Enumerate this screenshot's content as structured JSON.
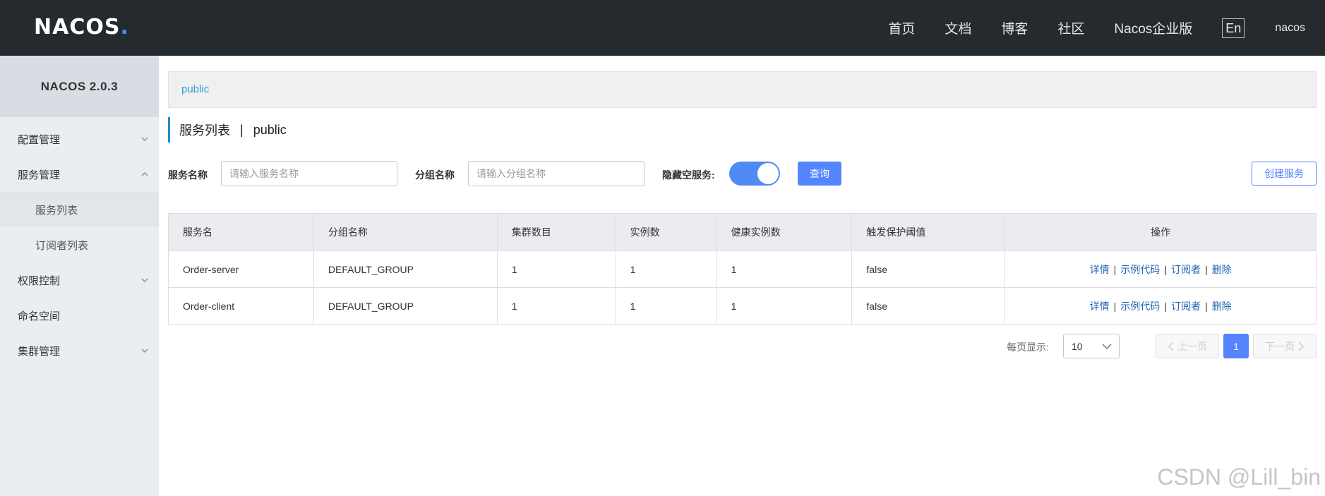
{
  "header": {
    "logo_text": "NACOS",
    "logo_dot": ".",
    "nav": [
      "首页",
      "文档",
      "博客",
      "社区",
      "Nacos企业版"
    ],
    "lang": "En",
    "user": "nacos"
  },
  "sidebar": {
    "title": "NACOS 2.0.3",
    "items": [
      {
        "label": "配置管理",
        "arrow": "down"
      },
      {
        "label": "服务管理",
        "arrow": "up"
      },
      {
        "label": "服务列表"
      },
      {
        "label": "订阅者列表"
      },
      {
        "label": "权限控制",
        "arrow": "down"
      },
      {
        "label": "命名空间"
      },
      {
        "label": "集群管理",
        "arrow": "down"
      }
    ]
  },
  "namespace": "public",
  "page": {
    "title": "服务列表",
    "separator": "|",
    "namespace": "public"
  },
  "filter": {
    "service_label": "服务名称",
    "service_placeholder": "请输入服务名称",
    "group_label": "分组名称",
    "group_placeholder": "请输入分组名称",
    "hide_empty_label": "隐藏空服务:",
    "hide_empty_on": true,
    "query_button": "查询",
    "create_button": "创建服务"
  },
  "table": {
    "columns": [
      "服务名",
      "分组名称",
      "集群数目",
      "实例数",
      "健康实例数",
      "触发保护阈值",
      "操作"
    ],
    "rows": [
      {
        "name": "Order-server",
        "group": "DEFAULT_GROUP",
        "clusters": "1",
        "instances": "1",
        "healthy": "1",
        "threshold": "false"
      },
      {
        "name": "Order-client",
        "group": "DEFAULT_GROUP",
        "clusters": "1",
        "instances": "1",
        "healthy": "1",
        "threshold": "false"
      }
    ],
    "ops": {
      "detail": "详情",
      "sample": "示例代码",
      "subscriber": "订阅者",
      "delete": "删除",
      "sep": "|"
    }
  },
  "pagination": {
    "page_size_label": "每页显示:",
    "page_size": "10",
    "prev": "上一页",
    "current": "1",
    "next": "下一页"
  },
  "watermark": "CSDN @Lill_bin",
  "colors": {
    "topbar": "#252a2f",
    "primary": "#5584ff",
    "link": "#1f64b5",
    "accent": "#1f8ece"
  }
}
